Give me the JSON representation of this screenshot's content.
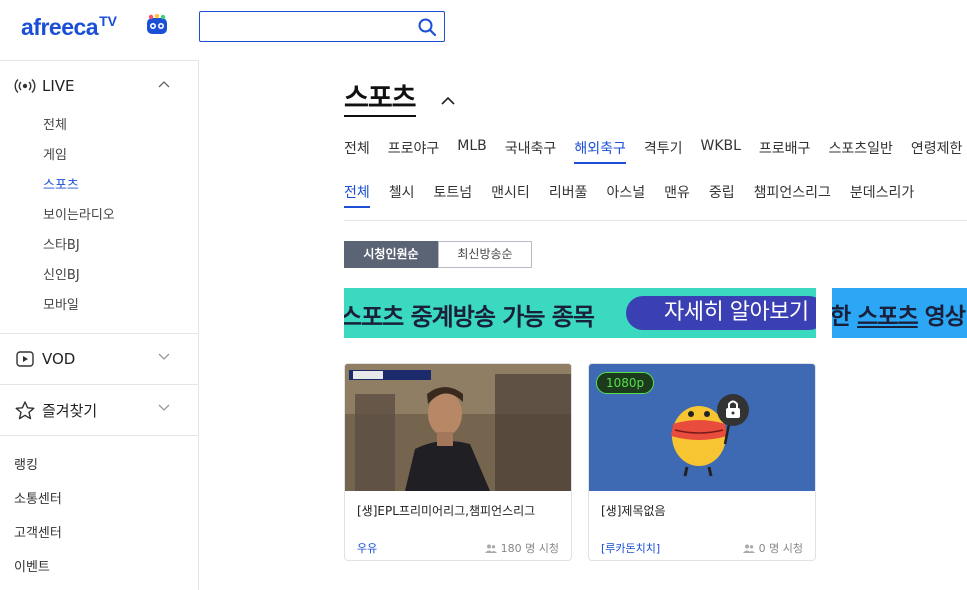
{
  "header": {
    "logo_text": "afreeca",
    "logo_tv": "TV",
    "search": {
      "value": "",
      "placeholder": ""
    }
  },
  "sidebar": {
    "live": {
      "label": "LIVE",
      "items": [
        {
          "label": "전체",
          "active": false
        },
        {
          "label": "게임",
          "active": false
        },
        {
          "label": "스포츠",
          "active": true
        },
        {
          "label": "보이는라디오",
          "active": false
        },
        {
          "label": "스타BJ",
          "active": false
        },
        {
          "label": "신인BJ",
          "active": false
        },
        {
          "label": "모바일",
          "active": false
        }
      ]
    },
    "vod": {
      "label": "VOD"
    },
    "favorites": {
      "label": "즐겨찾기"
    },
    "extra": [
      {
        "label": "랭킹"
      },
      {
        "label": "소통센터"
      },
      {
        "label": "고객센터"
      },
      {
        "label": "이벤트"
      }
    ]
  },
  "main": {
    "category_title": "스포츠",
    "tabs": [
      "전체",
      "프로야구",
      "MLB",
      "국내축구",
      "해외축구",
      "격투기",
      "WKBL",
      "프로배구",
      "스포츠일반",
      "연령제한"
    ],
    "active_tab": "해외축구",
    "subtabs": [
      "전체",
      "첼시",
      "토트넘",
      "맨시티",
      "리버풀",
      "아스널",
      "맨유",
      "중립",
      "챔피언스리그",
      "분데스리가"
    ],
    "active_subtab": "전체",
    "sort": {
      "viewers": "시청인원순",
      "latest": "최신방송순"
    },
    "banner1": {
      "text": "스포츠 중계방송 가능 종목",
      "button": "자세히 알아보기",
      "bg": "#3bd9c0",
      "pill": "#3a3fb3"
    },
    "banner2": {
      "text_prefix": "한 ",
      "text_under": "스포츠",
      "text_suffix": " 영상",
      "bg": "#2ba7f5"
    },
    "cards": [
      {
        "title": "[생]EPL프리미어리그,챔피언스리그",
        "author": "우유",
        "viewers": "180 명 시청"
      },
      {
        "title": "[생]제목없음",
        "author": "[루카돈치치]",
        "viewers": "0 명 시청",
        "badge": "1080p"
      }
    ]
  },
  "colors": {
    "accent": "#1b4fd6",
    "badge_green": "#56e04c"
  }
}
